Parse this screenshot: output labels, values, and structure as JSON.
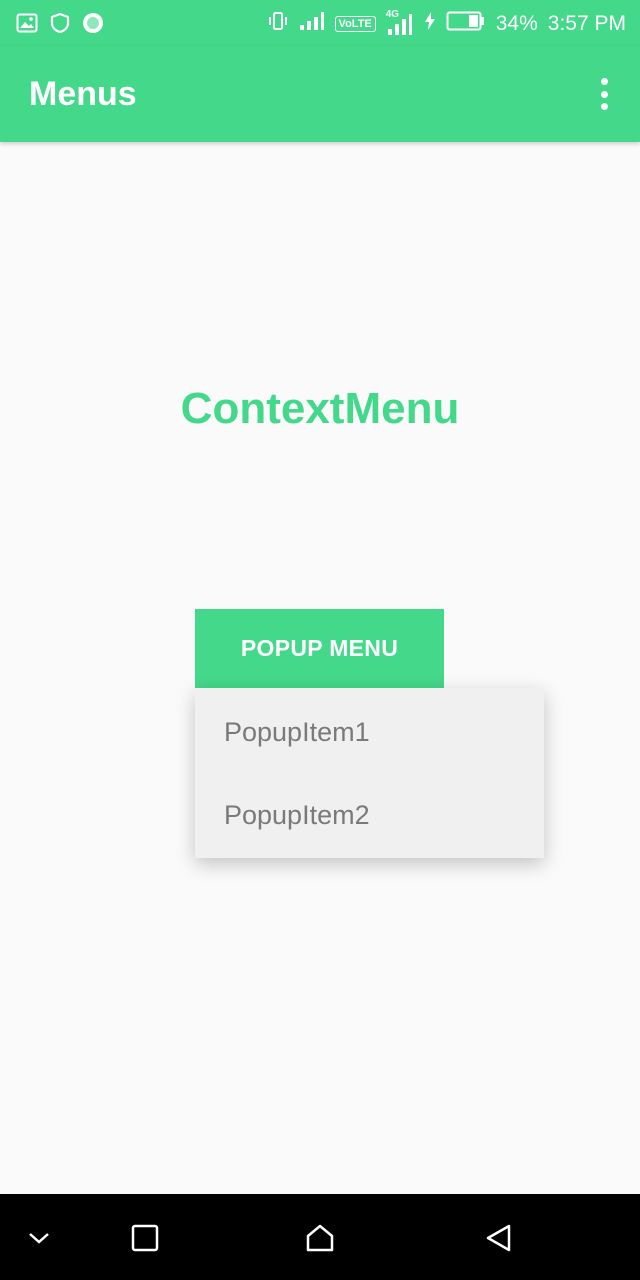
{
  "status_bar": {
    "battery_percent": "34%",
    "time": "3:57 PM",
    "network_badge": "VoLTE",
    "network_type": "4G",
    "icons": [
      "gallery-icon",
      "shield-icon",
      "circle-app-icon",
      "vibrate-icon",
      "signal-icon",
      "volte-icon",
      "4g-signal-icon",
      "charging-icon",
      "battery-icon"
    ]
  },
  "app_bar": {
    "title": "Menus",
    "overflow_icon": "more-vert-icon"
  },
  "main": {
    "context_menu_label": "ContextMenu",
    "popup_button_label": "POPUP MENU"
  },
  "popup_menu": {
    "items": [
      {
        "label": "PopupItem1"
      },
      {
        "label": "PopupItem2"
      }
    ]
  },
  "nav_bar": {
    "icons": [
      "chevron-down-icon",
      "recents-square-icon",
      "home-icon",
      "back-triangle-icon"
    ]
  },
  "colors": {
    "accent": "#43d88a",
    "background": "#fafafa",
    "menu_background": "#f0f0f0",
    "menu_text": "#7a7a7a",
    "nav_background": "#000000"
  }
}
